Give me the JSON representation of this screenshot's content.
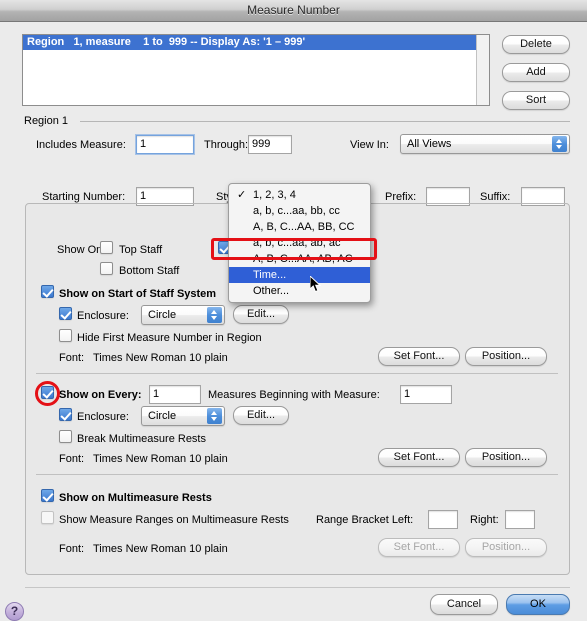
{
  "window": {
    "title": "Measure Number"
  },
  "region_list": {
    "rows": [
      {
        "text": "Region   1, measure    1 to  999 -- Display As: '1 – 999'",
        "selected": true
      }
    ]
  },
  "side_buttons": {
    "delete": "Delete",
    "add": "Add",
    "sort": "Sort"
  },
  "region_section": {
    "label": "Region 1",
    "includes_measure_label": "Includes Measure:",
    "includes_measure_value": "1",
    "through_label": "Through:",
    "through_value": "999",
    "view_in_label": "View In:",
    "view_in_value": "All Views",
    "starting_number_label": "Starting Number:",
    "starting_number_value": "1",
    "style_label": "Style:",
    "prefix_label": "Prefix:",
    "prefix_value": "",
    "suffix_label": "Suffix:",
    "suffix_value": ""
  },
  "style_menu": {
    "items": [
      {
        "label": "1, 2, 3, 4",
        "checked": true,
        "highlighted": false
      },
      {
        "label": "a, b, c...aa, bb, cc",
        "checked": false,
        "highlighted": false
      },
      {
        "label": "A, B, C...AA, BB, CC",
        "checked": false,
        "highlighted": false
      },
      {
        "label": "a, b, c...aa, ab, ac",
        "checked": false,
        "highlighted": false
      },
      {
        "label": "A, B, C...AA, AB, AC",
        "checked": false,
        "highlighted": false
      },
      {
        "label": "Time...",
        "checked": false,
        "highlighted": true
      },
      {
        "label": "Other...",
        "checked": false,
        "highlighted": false
      }
    ],
    "checkmark": "✓"
  },
  "show_on": {
    "label": "Show On:",
    "top_staff": "Top Staff",
    "top_staff_checked": false,
    "bottom_staff": "Bottom Staff",
    "bottom_staff_checked": false
  },
  "start_of_system": {
    "title": "Show on Start of Staff System",
    "title_checked": true,
    "enclosure_label": "Enclosure:",
    "enclosure_checked": true,
    "enclosure_value": "Circle",
    "edit_button": "Edit...",
    "hide_first": "Hide First Measure Number in Region",
    "hide_first_checked": false,
    "font_label": "Font:",
    "font_value": "Times New Roman 10 plain",
    "set_font_button": "Set Font...",
    "position_button": "Position..."
  },
  "show_every": {
    "title": "Show on Every:",
    "title_checked": true,
    "every_value": "1",
    "measures_label": "Measures Beginning with Measure:",
    "measures_value": "1",
    "enclosure_label": "Enclosure:",
    "enclosure_checked": true,
    "enclosure_value": "Circle",
    "edit_button": "Edit...",
    "break_rests": "Break Multimeasure Rests",
    "break_rests_checked": false,
    "font_label": "Font:",
    "font_value": "Times New Roman 10 plain",
    "set_font_button": "Set Font...",
    "position_button": "Position..."
  },
  "multimeasure": {
    "show_on_rests": "Show on Multimeasure Rests",
    "show_on_rests_checked": true,
    "show_ranges": "Show Measure Ranges on Multimeasure Rests",
    "show_ranges_checked": false,
    "bracket_left_label": "Range Bracket Left:",
    "bracket_left_value": "",
    "bracket_right_label": "Right:",
    "bracket_right_value": "",
    "font_label": "Font:",
    "font_value": "Times New Roman 10 plain",
    "set_font_button": "Set Font...",
    "position_button": "Position..."
  },
  "footer": {
    "help": "?",
    "cancel": "Cancel",
    "ok": "OK"
  }
}
